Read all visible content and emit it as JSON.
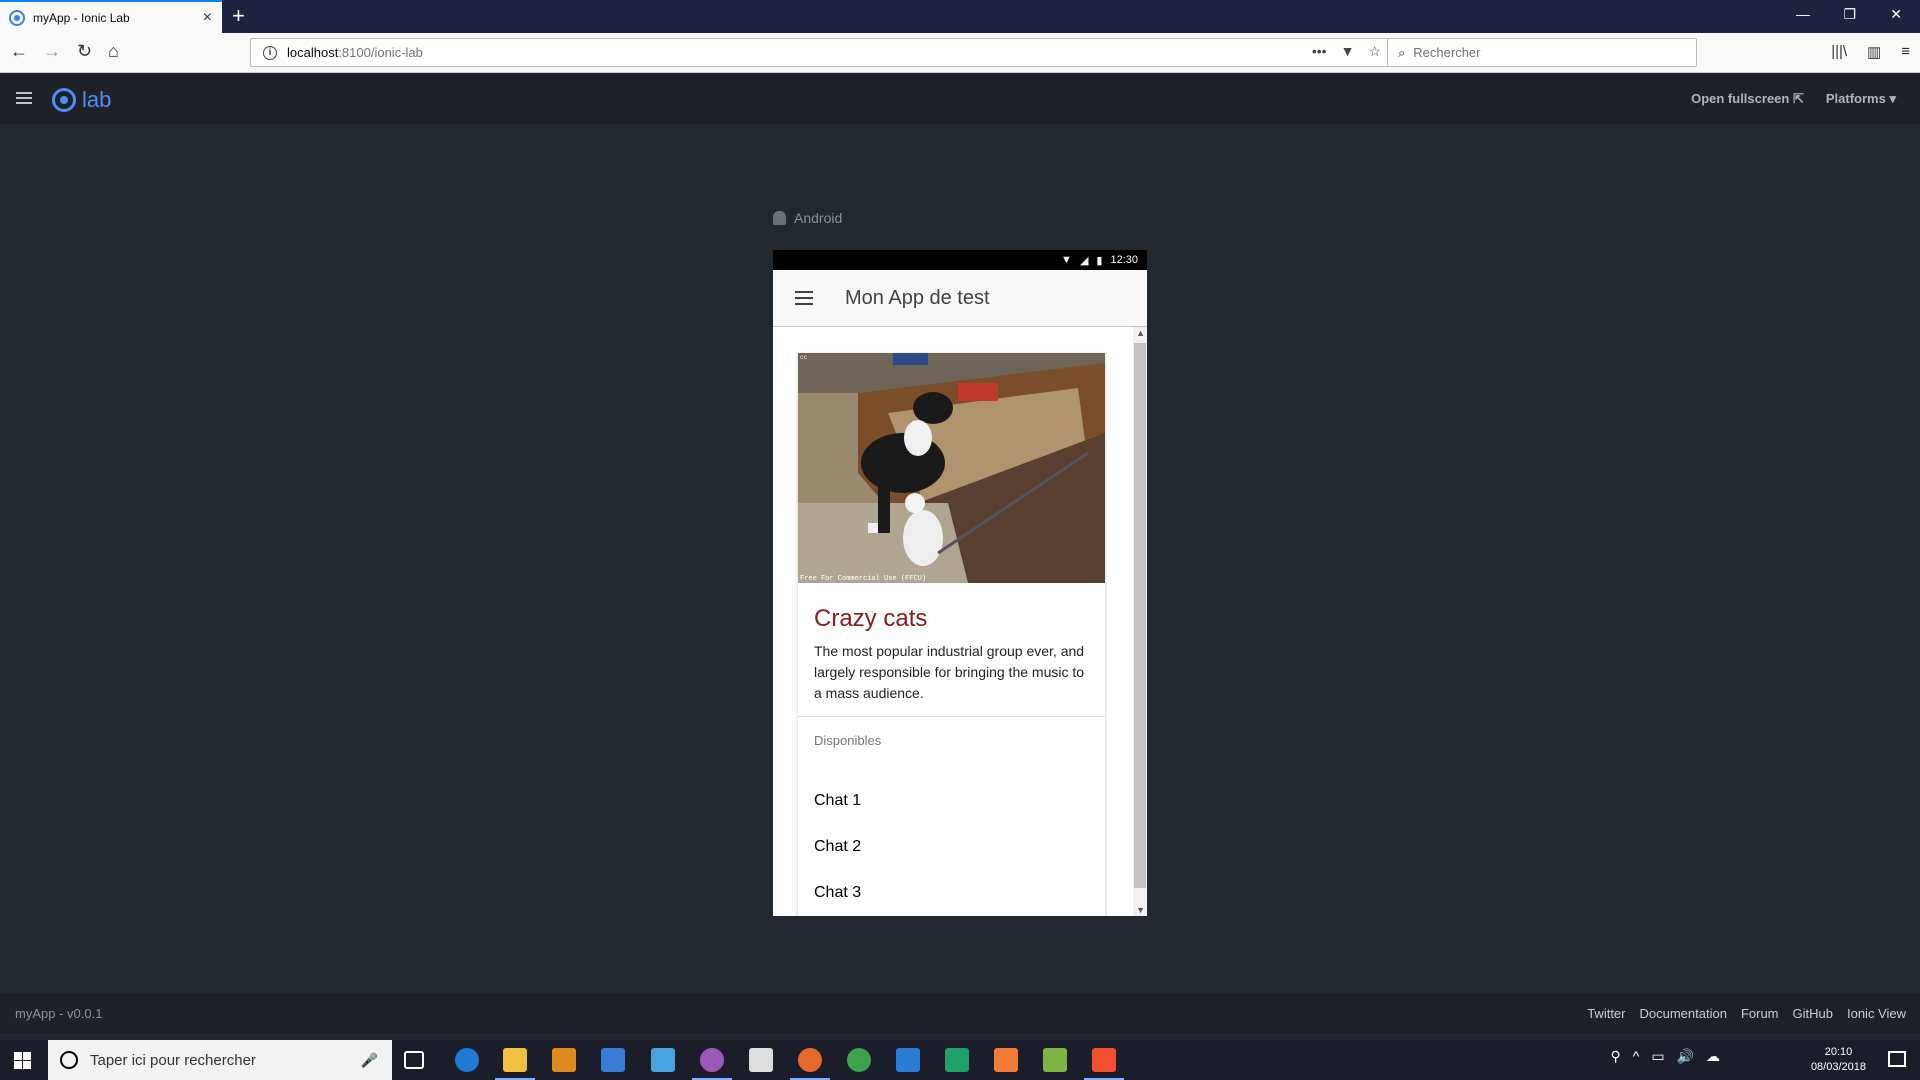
{
  "browser": {
    "tab_title": "myApp - Ionic Lab",
    "url_host": "localhost",
    "url_path": ":8100/ionic-lab",
    "search_placeholder": "Rechercher"
  },
  "lab": {
    "logo_text": "lab",
    "open_fullscreen": "Open fullscreen",
    "platforms": "Platforms"
  },
  "device": {
    "platform": "Android",
    "status_time": "12:30",
    "app_title": "Mon App de test"
  },
  "card": {
    "title": "Crazy cats",
    "text": "The most popular industrial group ever, and largely responsible for bringing the music to a mass audience.",
    "list_header": "Disponibles",
    "items": [
      "Chat 1",
      "Chat 2",
      "Chat 3"
    ],
    "image_caption": "Free For Commercial Use (FFCU)",
    "image_corner": "cc"
  },
  "footer": {
    "version": "myApp - v0.0.1",
    "links": [
      "Twitter",
      "Documentation",
      "Forum",
      "GitHub",
      "Ionic View"
    ]
  },
  "taskbar": {
    "search_placeholder": "Taper ici pour rechercher",
    "time": "20:10",
    "date": "08/03/2018"
  },
  "colors": {
    "ionic_blue": "#4f8ef7",
    "card_title": "#8b1a1a",
    "lab_bg": "#23272e"
  }
}
